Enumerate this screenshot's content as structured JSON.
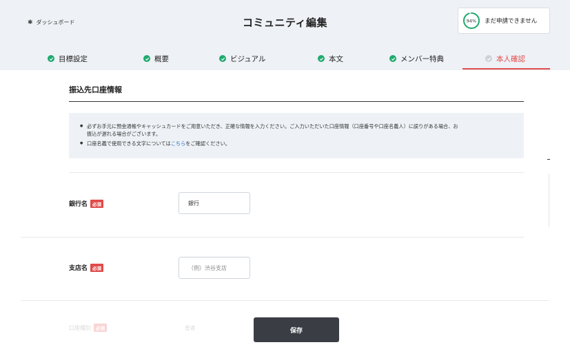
{
  "header": {
    "dashboard_link": "ダッシュボード",
    "title": "コミュニティ編集",
    "progress": {
      "percent": 94,
      "percent_label": "94%",
      "status_text": "まだ申請できません"
    }
  },
  "tabs": [
    {
      "label": "目標設定",
      "done": true
    },
    {
      "label": "概要",
      "done": true
    },
    {
      "label": "ビジュアル",
      "done": true
    },
    {
      "label": "本文",
      "done": true
    },
    {
      "label": "メンバー特典",
      "done": true
    },
    {
      "label": "本人確認",
      "done": false,
      "active": true
    }
  ],
  "section": {
    "title": "振込先口座情報",
    "notice_1a": "必ずお手元に預金通帳やキャッシュカードをご用意いただき、正確な情報を入力ください。ご入力いただいた口座情報（口座番号や口座名義人）に誤りがある場合、お",
    "notice_1b": "振込が遅れる場合がございます。",
    "notice_2_pre": "口座名義で使用できる文字については",
    "notice_2_link": "こちら",
    "notice_2_post": "をご確認ください。"
  },
  "fields": {
    "bank": {
      "label": "銀行名",
      "required": "必須",
      "value": "銀行"
    },
    "branch": {
      "label": "支店名",
      "required": "必須",
      "placeholder": "（例）渋谷支店"
    },
    "account_type": {
      "label": "口座種別",
      "required": "必須",
      "value": "普通"
    }
  },
  "actions": {
    "save_label": "保存"
  },
  "colors": {
    "accent": "#e04a4a",
    "done": "#1faa6e",
    "progress": "#1faa6e"
  }
}
